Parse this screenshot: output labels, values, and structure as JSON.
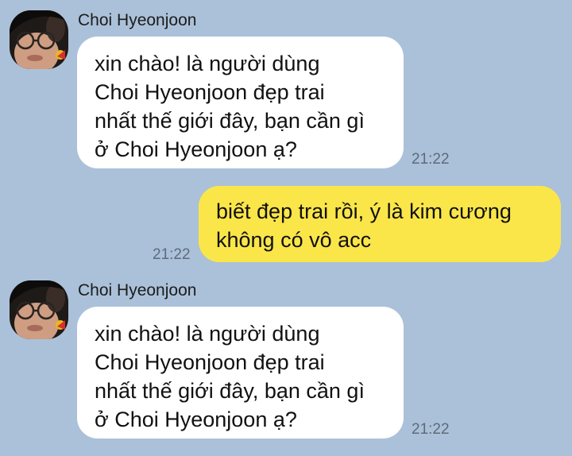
{
  "messages": [
    {
      "direction": "incoming",
      "sender": "Choi Hyeonjoon",
      "avatar_icon": "profile-photo-icon",
      "lines": [
        "xin chào! là người dùng",
        "Choi Hyeonjoon đẹp trai",
        "nhất thế giới đây, bạn cần gì",
        "ở Choi Hyeonjoon ạ?"
      ],
      "time": "21:22"
    },
    {
      "direction": "outgoing",
      "lines": [
        "biết đẹp trai rồi, ý là kim cương",
        "không có vô acc"
      ],
      "time": "21:22"
    },
    {
      "direction": "incoming",
      "sender": "Choi Hyeonjoon",
      "avatar_icon": "profile-photo-icon",
      "lines": [
        "xin chào! là người dùng",
        "Choi Hyeonjoon đẹp trai",
        "nhất thế giới đây, bạn cần gì",
        "ở Choi Hyeonjoon ạ?"
      ],
      "time": "21:22"
    }
  ],
  "colors": {
    "background": "#abc1d9",
    "incoming_bubble": "#ffffff",
    "outgoing_bubble": "#fbe64a",
    "timestamp": "#5d6b7a"
  }
}
